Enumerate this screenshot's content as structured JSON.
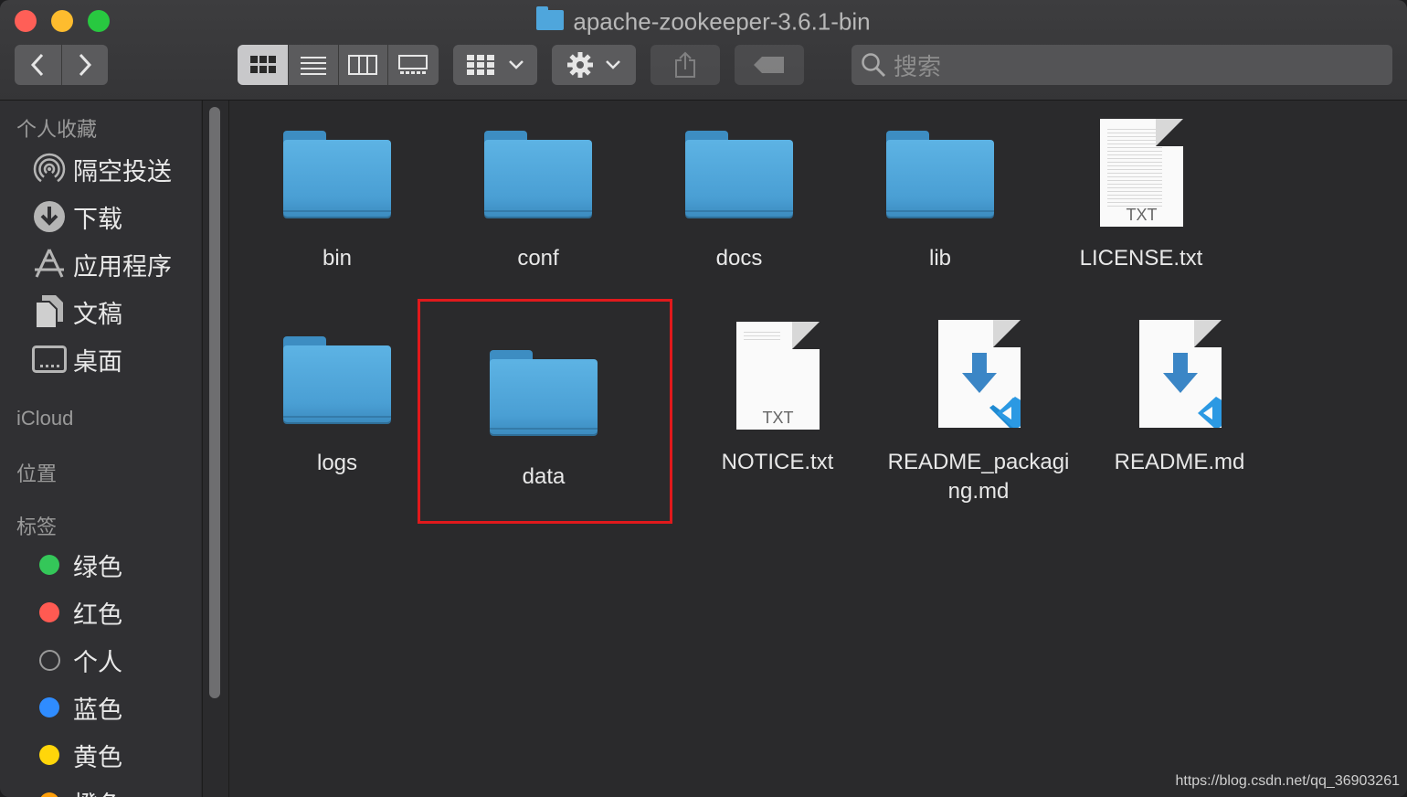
{
  "window": {
    "title": "apache-zookeeper-3.6.1-bin"
  },
  "toolbar": {
    "search_placeholder": "搜索"
  },
  "sidebar": {
    "favorites_header": "个人收藏",
    "favorites": [
      {
        "label": "隔空投送",
        "icon": "airdrop-icon"
      },
      {
        "label": "下载",
        "icon": "download-icon"
      },
      {
        "label": "应用程序",
        "icon": "applications-icon"
      },
      {
        "label": "文稿",
        "icon": "documents-icon"
      },
      {
        "label": "桌面",
        "icon": "desktop-icon"
      }
    ],
    "icloud_header": "iCloud",
    "locations_header": "位置",
    "tags_header": "标签",
    "tags": [
      {
        "label": "绿色",
        "color": "#34c759"
      },
      {
        "label": "红色",
        "color": "#ff5a52"
      },
      {
        "label": "个人",
        "color": "none"
      },
      {
        "label": "蓝色",
        "color": "#2f8cff"
      },
      {
        "label": "黄色",
        "color": "#ffd60a"
      },
      {
        "label": "橙色",
        "color": "#ff9f0a"
      }
    ]
  },
  "files": [
    {
      "name": "bin",
      "kind": "folder"
    },
    {
      "name": "conf",
      "kind": "folder"
    },
    {
      "name": "docs",
      "kind": "folder"
    },
    {
      "name": "lib",
      "kind": "folder"
    },
    {
      "name": "LICENSE.txt",
      "kind": "txt",
      "badge": "TXT"
    },
    {
      "name": "logs",
      "kind": "folder"
    },
    {
      "name": "data",
      "kind": "folder",
      "highlighted": true
    },
    {
      "name": "NOTICE.txt",
      "kind": "txt",
      "badge": "TXT"
    },
    {
      "name": "README_packaging.md",
      "kind": "md",
      "label_lines": [
        "README_packagi",
        "ng.md"
      ]
    },
    {
      "name": "README.md",
      "kind": "md"
    }
  ],
  "watermark": "https://blog.csdn.net/qq_36903261"
}
